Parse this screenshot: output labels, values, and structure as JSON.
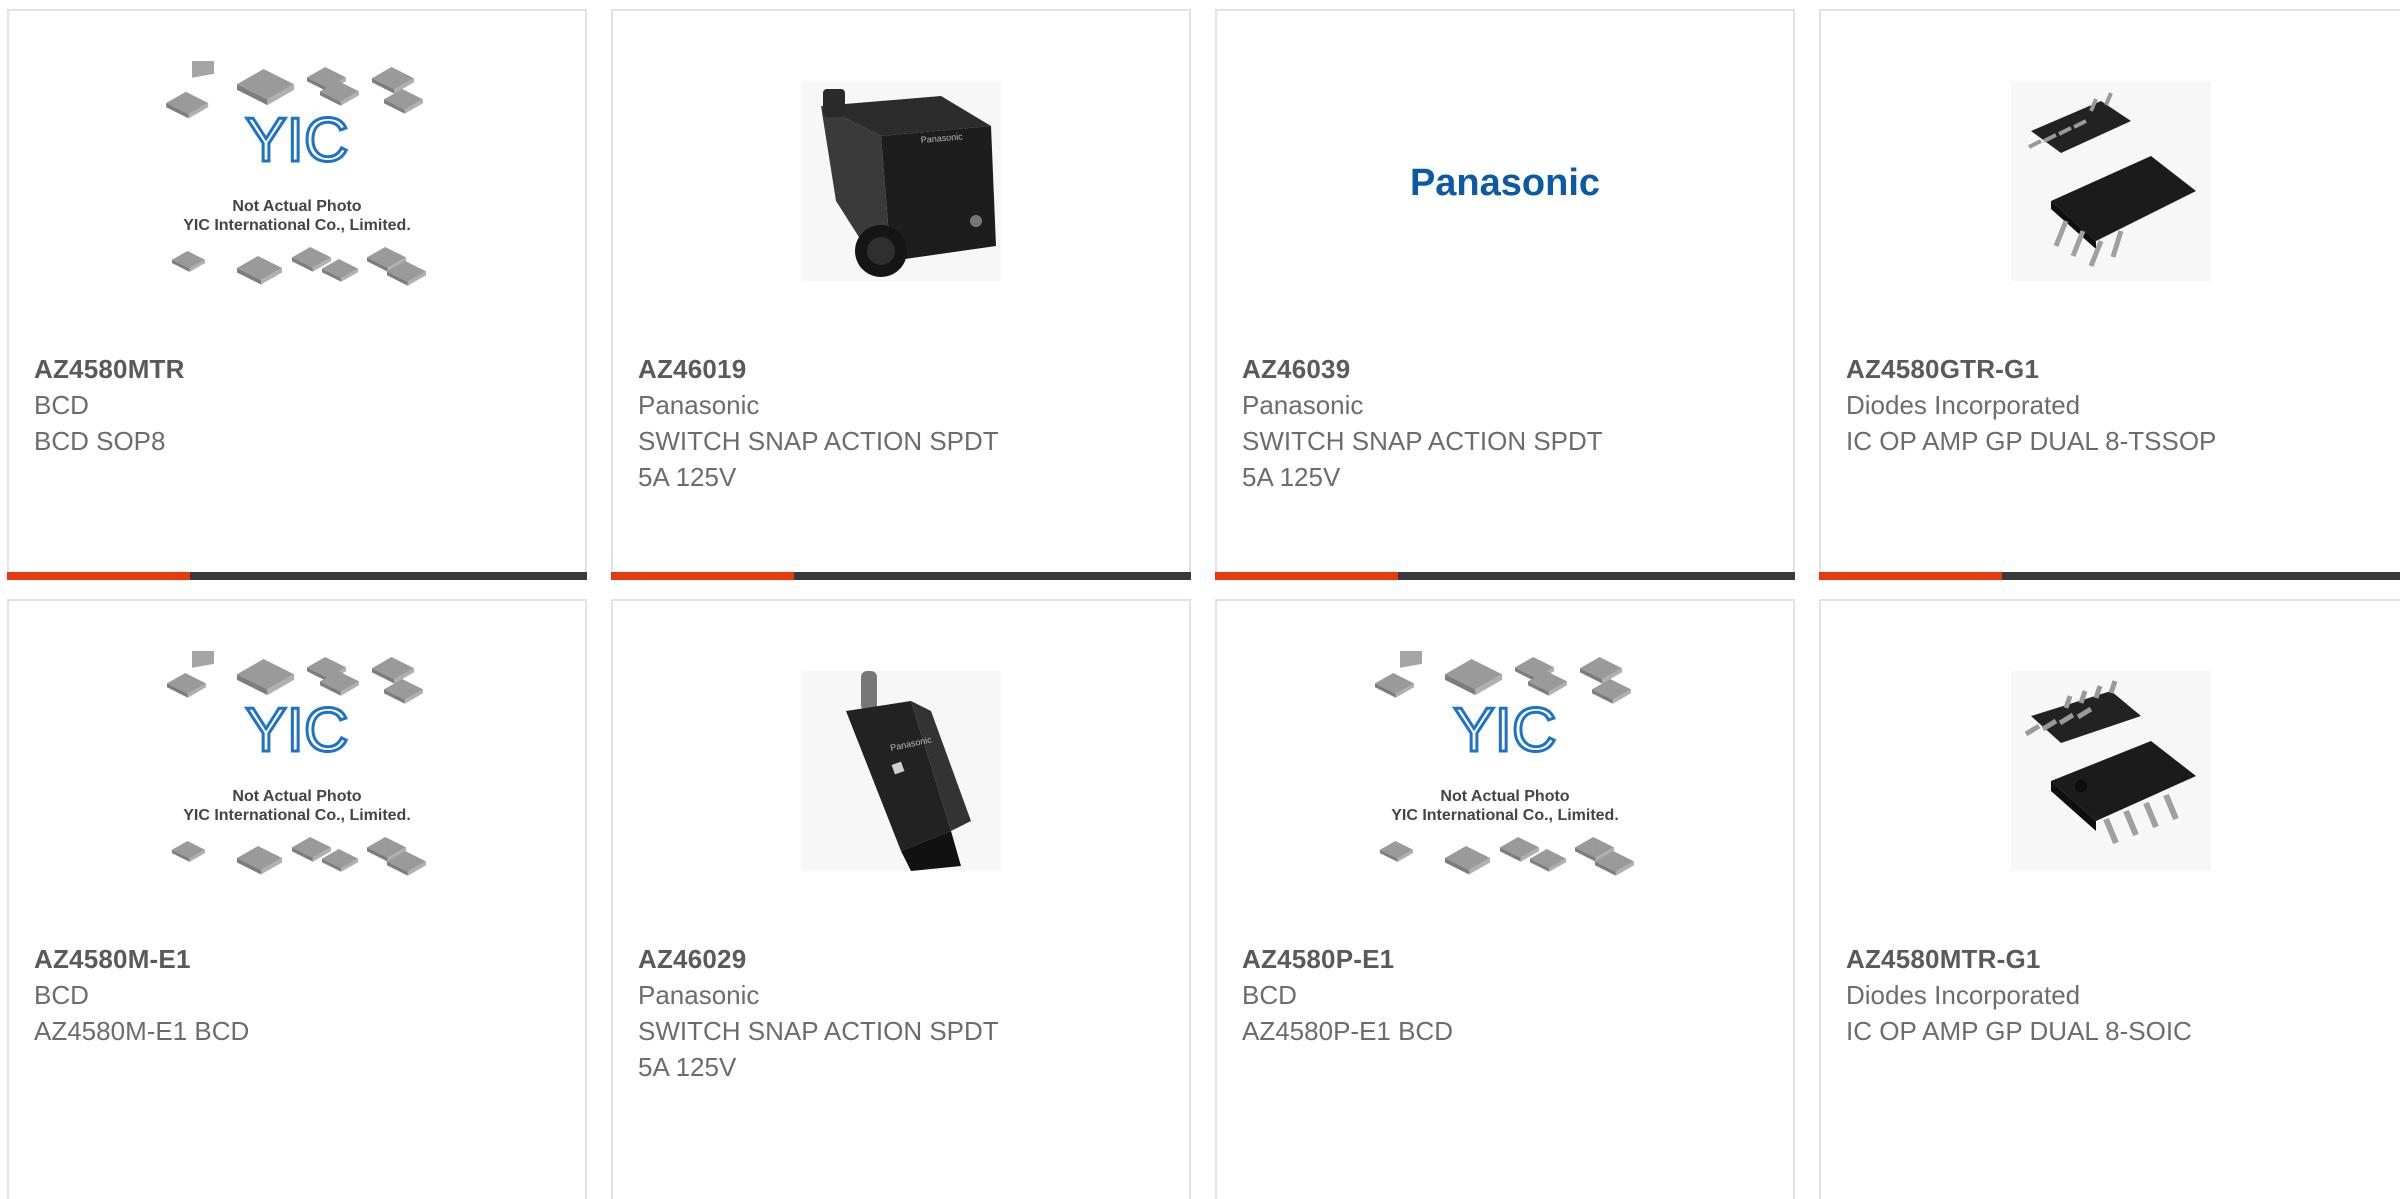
{
  "colors": {
    "accent": "#e8380d",
    "bar_dark": "#3a3a3a",
    "panasonic_blue": "#0b5aa8",
    "yic_blue": "#1e72c9"
  },
  "products": [
    {
      "part": "AZ4580MTR",
      "manufacturer": "BCD",
      "description": "BCD SOP8",
      "image": "yic-placeholder"
    },
    {
      "part": "AZ46019",
      "manufacturer": "Panasonic",
      "description": "SWITCH SNAP ACTION SPDT\n5A 125V",
      "image": "snap-switch-photo"
    },
    {
      "part": "AZ46039",
      "manufacturer": "Panasonic",
      "description": "SWITCH SNAP ACTION SPDT\n5A 125V",
      "image": "panasonic-logo"
    },
    {
      "part": "AZ4580GTR-G1",
      "manufacturer": "Diodes Incorporated",
      "description": "IC OP AMP GP DUAL 8-TSSOP",
      "image": "ic-chip-photo"
    },
    {
      "part": "AZ4580M-E1",
      "manufacturer": "BCD",
      "description": "AZ4580M-E1 BCD",
      "image": "yic-placeholder"
    },
    {
      "part": "AZ46029",
      "manufacturer": "Panasonic",
      "description": "SWITCH SNAP ACTION SPDT\n5A 125V",
      "image": "snap-switch-photo"
    },
    {
      "part": "AZ4580P-E1",
      "manufacturer": "BCD",
      "description": "AZ4580P-E1 BCD",
      "image": "yic-placeholder"
    },
    {
      "part": "AZ4580MTR-G1",
      "manufacturer": "Diodes Incorporated",
      "description": "IC OP AMP GP DUAL 8-SOIC",
      "image": "ic-chip-photo"
    }
  ],
  "placeholder": {
    "logo_text": "YIC",
    "line1": "Not Actual Photo",
    "line2": "YIC International Co., Limited."
  },
  "brand_logo_text": "Panasonic"
}
